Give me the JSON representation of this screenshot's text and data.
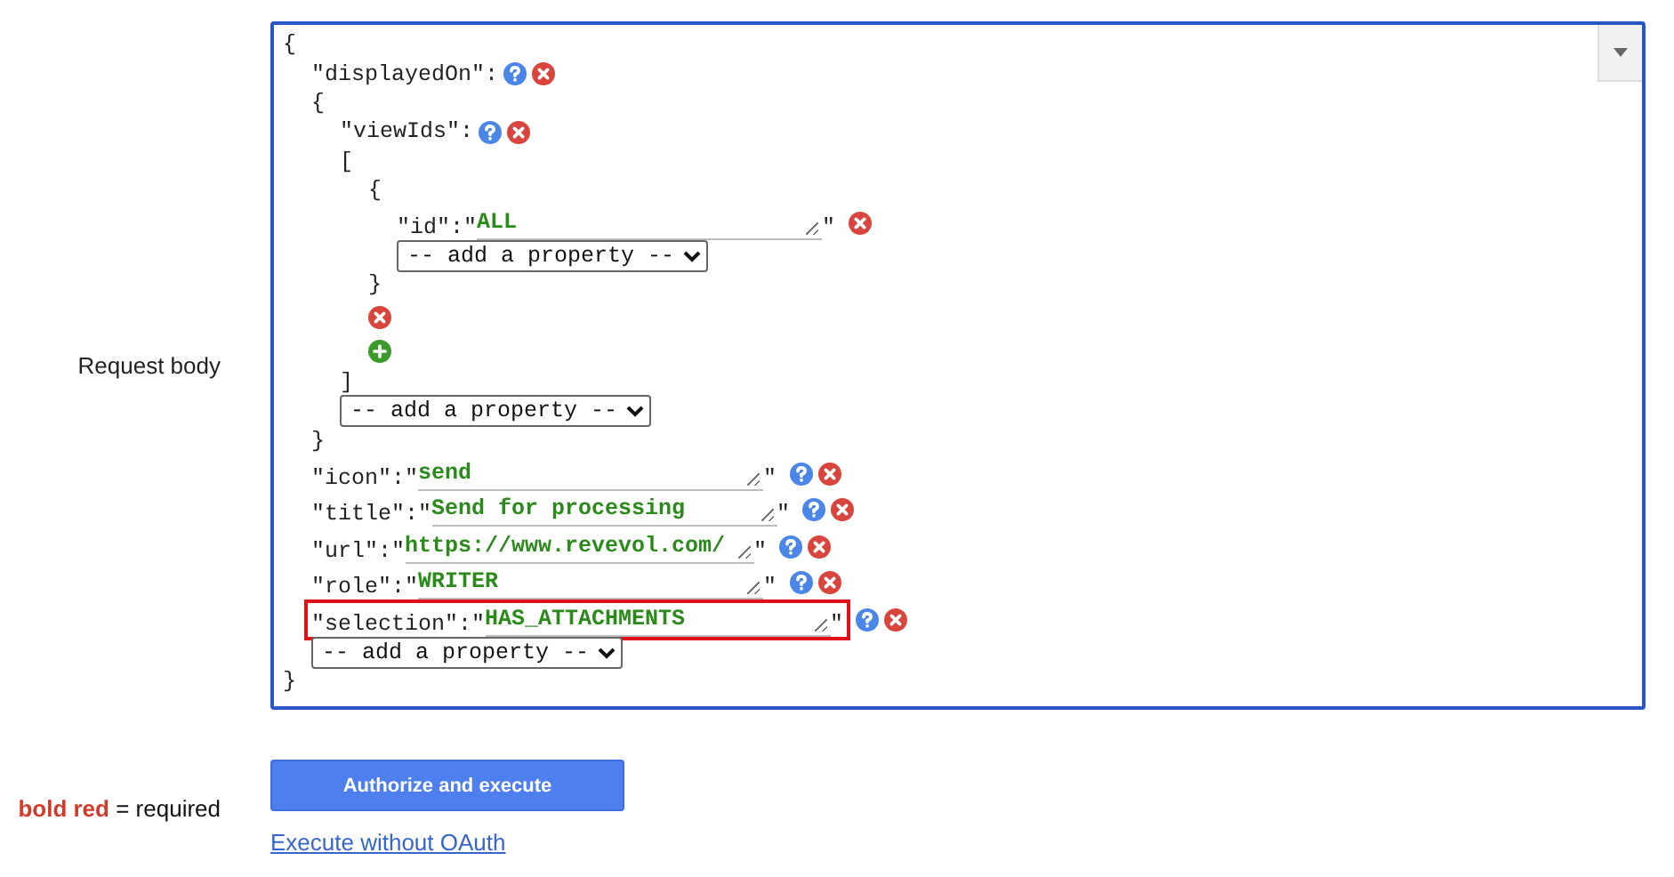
{
  "request_body": {
    "label": "Request body",
    "menu_button": true,
    "editor": {
      "kind": "object",
      "open": "{",
      "close": "}",
      "add": "-- add a property --",
      "members": [
        {
          "key": "\"displayedOn\":",
          "help": true,
          "value": {
            "kind": "object",
            "open": "{",
            "close": "}",
            "add": "-- add a property --",
            "members": [
              {
                "key": "\"viewIds\":",
                "help": true,
                "value": {
                  "kind": "array",
                  "open": "[",
                  "close": "]",
                  "items": [
                    {
                      "kind": "object",
                      "open": "{",
                      "close": "}",
                      "add": "-- add a property --",
                      "members": [
                        {
                          "key": "\"id\":\"",
                          "help": false,
                          "highlighted": false,
                          "value": {
                            "kind": "string",
                            "text": "ALL",
                            "close": "\""
                          }
                        }
                      ]
                    }
                  ]
                }
              }
            ]
          }
        },
        {
          "key": "\"icon\":\"",
          "help": true,
          "highlighted": false,
          "value": {
            "kind": "string",
            "text": "send",
            "close": "\""
          }
        },
        {
          "key": "\"title\":\"",
          "help": true,
          "highlighted": false,
          "value": {
            "kind": "string",
            "text": "Send for processing",
            "close": "\""
          }
        },
        {
          "key": "\"url\":\"",
          "help": true,
          "highlighted": false,
          "value": {
            "kind": "string",
            "text": "https://www.revevol.com/",
            "close": "\""
          }
        },
        {
          "key": "\"role\":\"",
          "help": true,
          "highlighted": false,
          "value": {
            "kind": "string",
            "text": "WRITER",
            "close": "\""
          }
        },
        {
          "key": "\"selection\":\"",
          "help": true,
          "highlighted": true,
          "value": {
            "kind": "string",
            "text": "HAS_ATTACHMENTS",
            "close": "\""
          }
        }
      ]
    }
  },
  "legend": "**bold red** = required",
  "execute_button": "Authorize and execute",
  "link": "Execute without OAuth"
}
